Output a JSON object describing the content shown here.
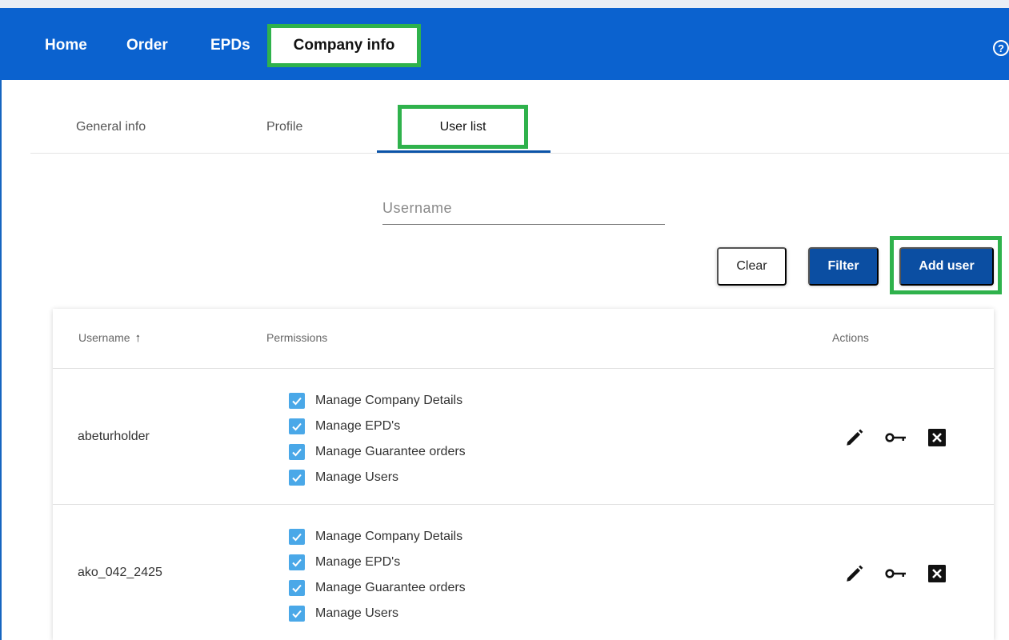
{
  "nav": {
    "home": "Home",
    "order": "Order",
    "epds": "EPDs",
    "company_info": "Company info",
    "help_icon": "question-circle-icon"
  },
  "subtabs": {
    "general": "General info",
    "profile": "Profile",
    "users": "User list"
  },
  "filter": {
    "username_placeholder": "Username",
    "username_value": "",
    "clear_label": "Clear",
    "filter_label": "Filter",
    "add_user_label": "Add user"
  },
  "table": {
    "headers": {
      "username": "Username",
      "permissions": "Permissions",
      "actions": "Actions"
    },
    "sort_icon": "arrow-up-icon",
    "rows": [
      {
        "username": "abeturholder",
        "permissions": [
          "Manage Company Details",
          "Manage EPD's",
          "Manage Guarantee orders",
          "Manage Users"
        ]
      },
      {
        "username": "ako_042_2425",
        "permissions": [
          "Manage Company Details",
          "Manage EPD's",
          "Manage Guarantee orders",
          "Manage Users"
        ]
      }
    ]
  },
  "colors": {
    "nav_bg": "#0b62cf",
    "primary_button": "#0b4ea2",
    "highlight": "#2fb24c",
    "checkbox": "#4aa8e8"
  }
}
